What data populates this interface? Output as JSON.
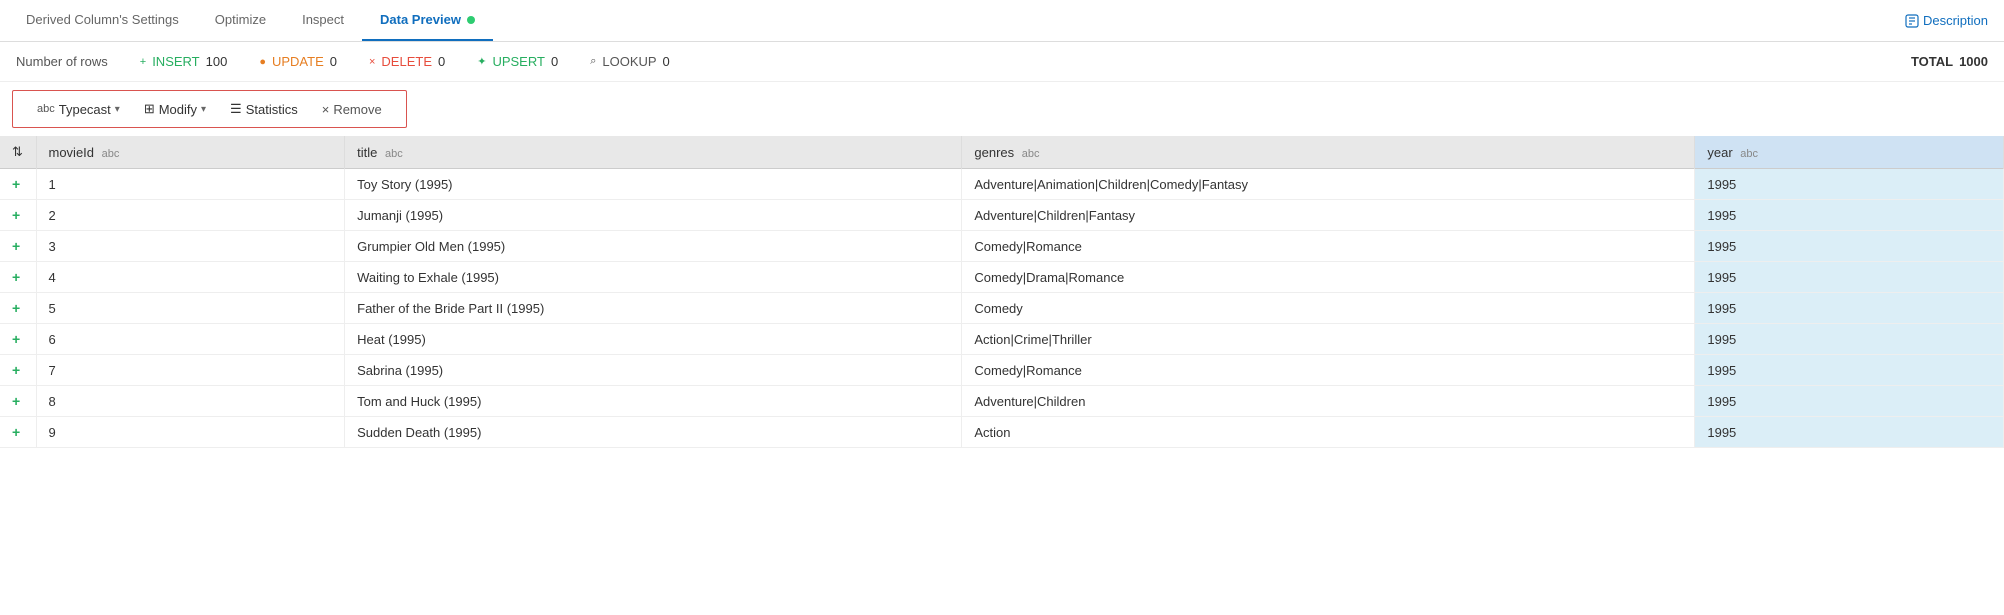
{
  "tabs": [
    {
      "id": "derived",
      "label": "Derived Column's Settings",
      "active": false
    },
    {
      "id": "optimize",
      "label": "Optimize",
      "active": false
    },
    {
      "id": "inspect",
      "label": "Inspect",
      "active": false
    },
    {
      "id": "datapreview",
      "label": "Data Preview",
      "active": true
    }
  ],
  "description_btn": "Description",
  "stats": {
    "rows_label": "Number of rows",
    "insert_icon": "+",
    "insert_label": "INSERT",
    "insert_value": "100",
    "update_icon": "●",
    "update_label": "UPDATE",
    "update_value": "0",
    "delete_icon": "×",
    "delete_label": "DELETE",
    "delete_value": "0",
    "upsert_icon": "+●",
    "upsert_label": "UPSERT",
    "upsert_value": "0",
    "lookup_icon": "🔍",
    "lookup_label": "LOOKUP",
    "lookup_value": "0",
    "total_label": "TOTAL",
    "total_value": "1000"
  },
  "toolbar": {
    "typecast_label": "Typecast",
    "typecast_icon": "abc",
    "modify_label": "Modify",
    "modify_icon": "⊞",
    "statistics_label": "Statistics",
    "statistics_icon": "≡",
    "remove_label": "Remove",
    "remove_icon": "×"
  },
  "table": {
    "columns": [
      {
        "id": "expand",
        "label": "⇅",
        "type": ""
      },
      {
        "id": "movieId",
        "label": "movieId",
        "type": "abc"
      },
      {
        "id": "title",
        "label": "title",
        "type": "abc"
      },
      {
        "id": "genres",
        "label": "genres",
        "type": "abc"
      },
      {
        "id": "year",
        "label": "year",
        "type": "abc",
        "highlighted": true
      }
    ],
    "rows": [
      {
        "expand": "+",
        "movieId": "1",
        "title": "Toy Story (1995)",
        "genres": "Adventure|Animation|Children|Comedy|Fantasy",
        "year": "1995"
      },
      {
        "expand": "+",
        "movieId": "2",
        "title": "Jumanji (1995)",
        "genres": "Adventure|Children|Fantasy",
        "year": "1995"
      },
      {
        "expand": "+",
        "movieId": "3",
        "title": "Grumpier Old Men (1995)",
        "genres": "Comedy|Romance",
        "year": "1995"
      },
      {
        "expand": "+",
        "movieId": "4",
        "title": "Waiting to Exhale (1995)",
        "genres": "Comedy|Drama|Romance",
        "year": "1995"
      },
      {
        "expand": "+",
        "movieId": "5",
        "title": "Father of the Bride Part II (1995)",
        "genres": "Comedy",
        "year": "1995"
      },
      {
        "expand": "+",
        "movieId": "6",
        "title": "Heat (1995)",
        "genres": "Action|Crime|Thriller",
        "year": "1995"
      },
      {
        "expand": "+",
        "movieId": "7",
        "title": "Sabrina (1995)",
        "genres": "Comedy|Romance",
        "year": "1995"
      },
      {
        "expand": "+",
        "movieId": "8",
        "title": "Tom and Huck (1995)",
        "genres": "Adventure|Children",
        "year": "1995"
      },
      {
        "expand": "+",
        "movieId": "9",
        "title": "Sudden Death (1995)",
        "genres": "Action",
        "year": "1995"
      }
    ]
  }
}
